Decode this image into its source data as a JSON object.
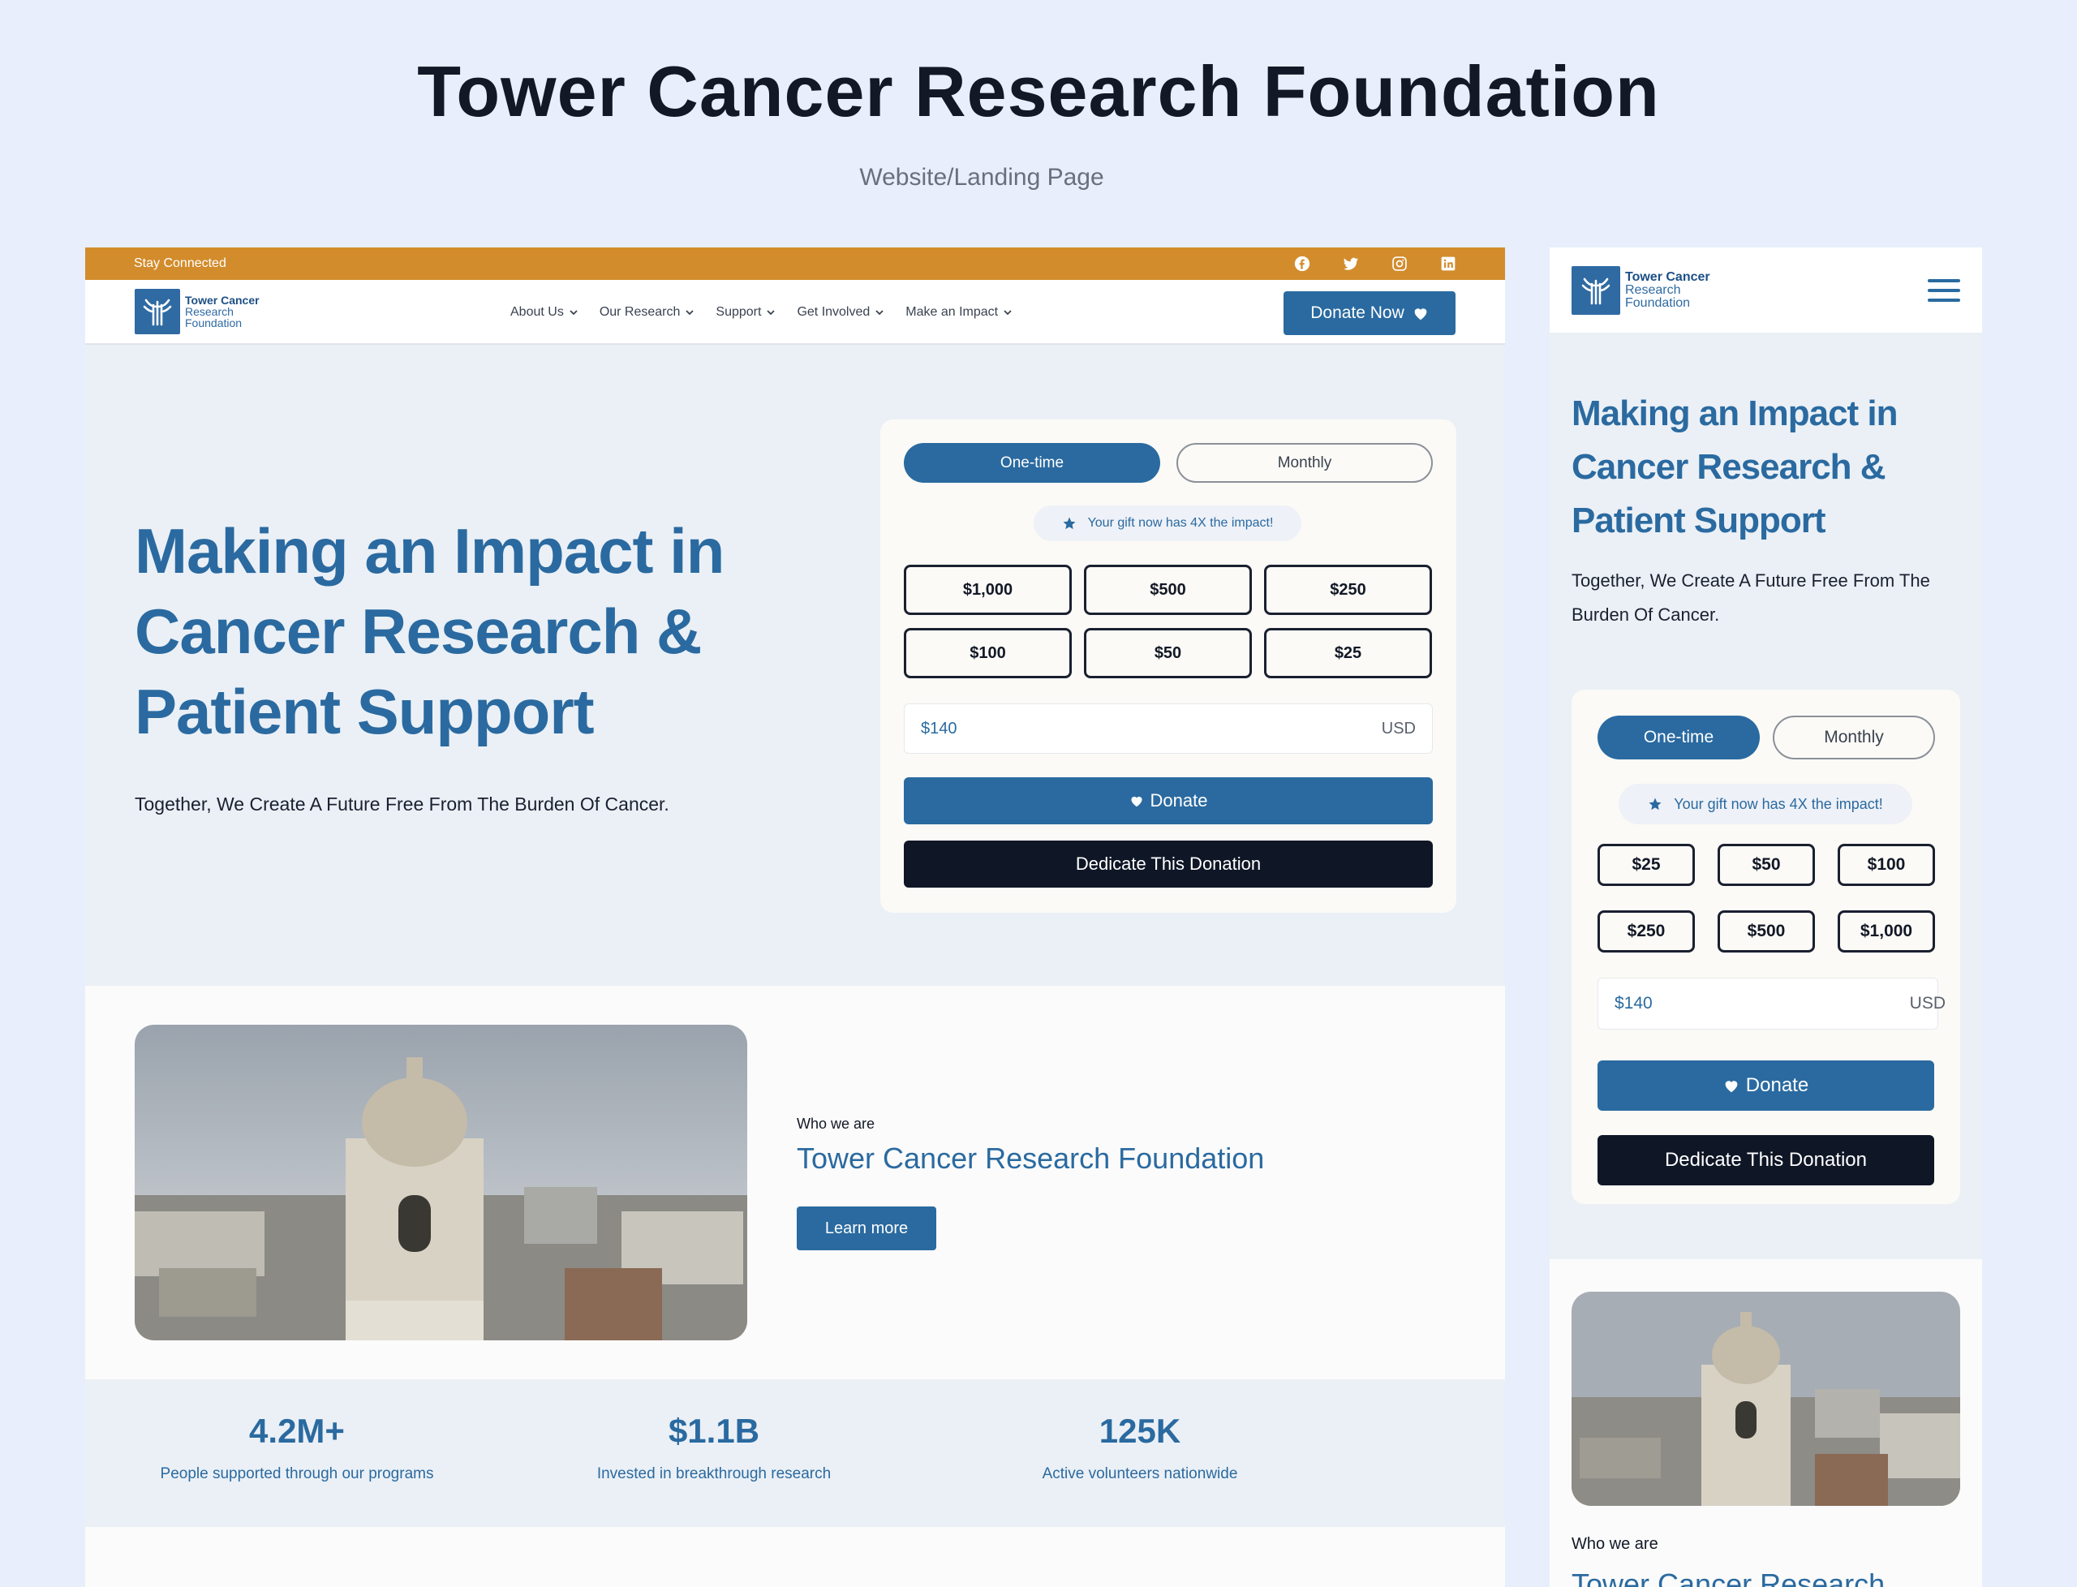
{
  "presentation": {
    "title": "Tower Cancer Research Foundation",
    "subtitle": "Website/Landing Page"
  },
  "colors": {
    "primary": "#2a6aa0",
    "topbar": "#d28c2c",
    "dark": "#0f1626",
    "background": "#e8eefc"
  },
  "desktop": {
    "topbar": {
      "text": "Stay Connected",
      "social_icons": [
        "facebook-icon",
        "twitter-icon",
        "instagram-icon",
        "linkedin-icon"
      ]
    },
    "logo": {
      "line1": "Tower Cancer",
      "line2": "Research",
      "line3": "Foundation"
    },
    "nav": [
      "About Us",
      "Our Research",
      "Support",
      "Get Involved",
      "Make an Impact"
    ],
    "donate_now": "Donate Now",
    "hero": {
      "title": "Making an Impact in Cancer Research & Patient Support",
      "subtitle": "Together, We Create A Future Free From The Burden Of Cancer."
    },
    "donation": {
      "one_time": "One-time",
      "monthly": "Monthly",
      "gift_note": "Your gift now has 4X the impact!",
      "amounts": [
        "$1,000",
        "$500",
        "$250",
        "$100",
        "$50",
        "$25"
      ],
      "custom_value": "$140",
      "currency": "USD",
      "donate": "Donate",
      "dedicate": "Dedicate This Donation"
    },
    "about": {
      "who": "Who we are",
      "title": "Tower Cancer Research Foundation",
      "learn_more": "Learn more"
    },
    "stats": [
      {
        "num": "4.2M+",
        "label": "People supported through our programs"
      },
      {
        "num": "$1.1B",
        "label": "Invested in breakthrough research"
      },
      {
        "num": "125K",
        "label": "Active volunteers nationwide"
      }
    ]
  },
  "mobile": {
    "logo": {
      "line1": "Tower Cancer",
      "line2": "Research",
      "line3": "Foundation"
    },
    "hero": {
      "title": "Making an Impact in Cancer Research & Patient Support",
      "subtitle": "Together, We Create A Future Free From The Burden Of Cancer."
    },
    "donation": {
      "one_time": "One-time",
      "monthly": "Monthly",
      "gift_note": "Your gift now has 4X the impact!",
      "amounts": [
        "$25",
        "$50",
        "$100",
        "$250",
        "$500",
        "$1,000"
      ],
      "custom_value": "$140",
      "currency": "USD",
      "donate": "Donate",
      "dedicate": "Dedicate This Donation"
    },
    "about": {
      "who": "Who we are",
      "title": "Tower Cancer Research"
    }
  }
}
